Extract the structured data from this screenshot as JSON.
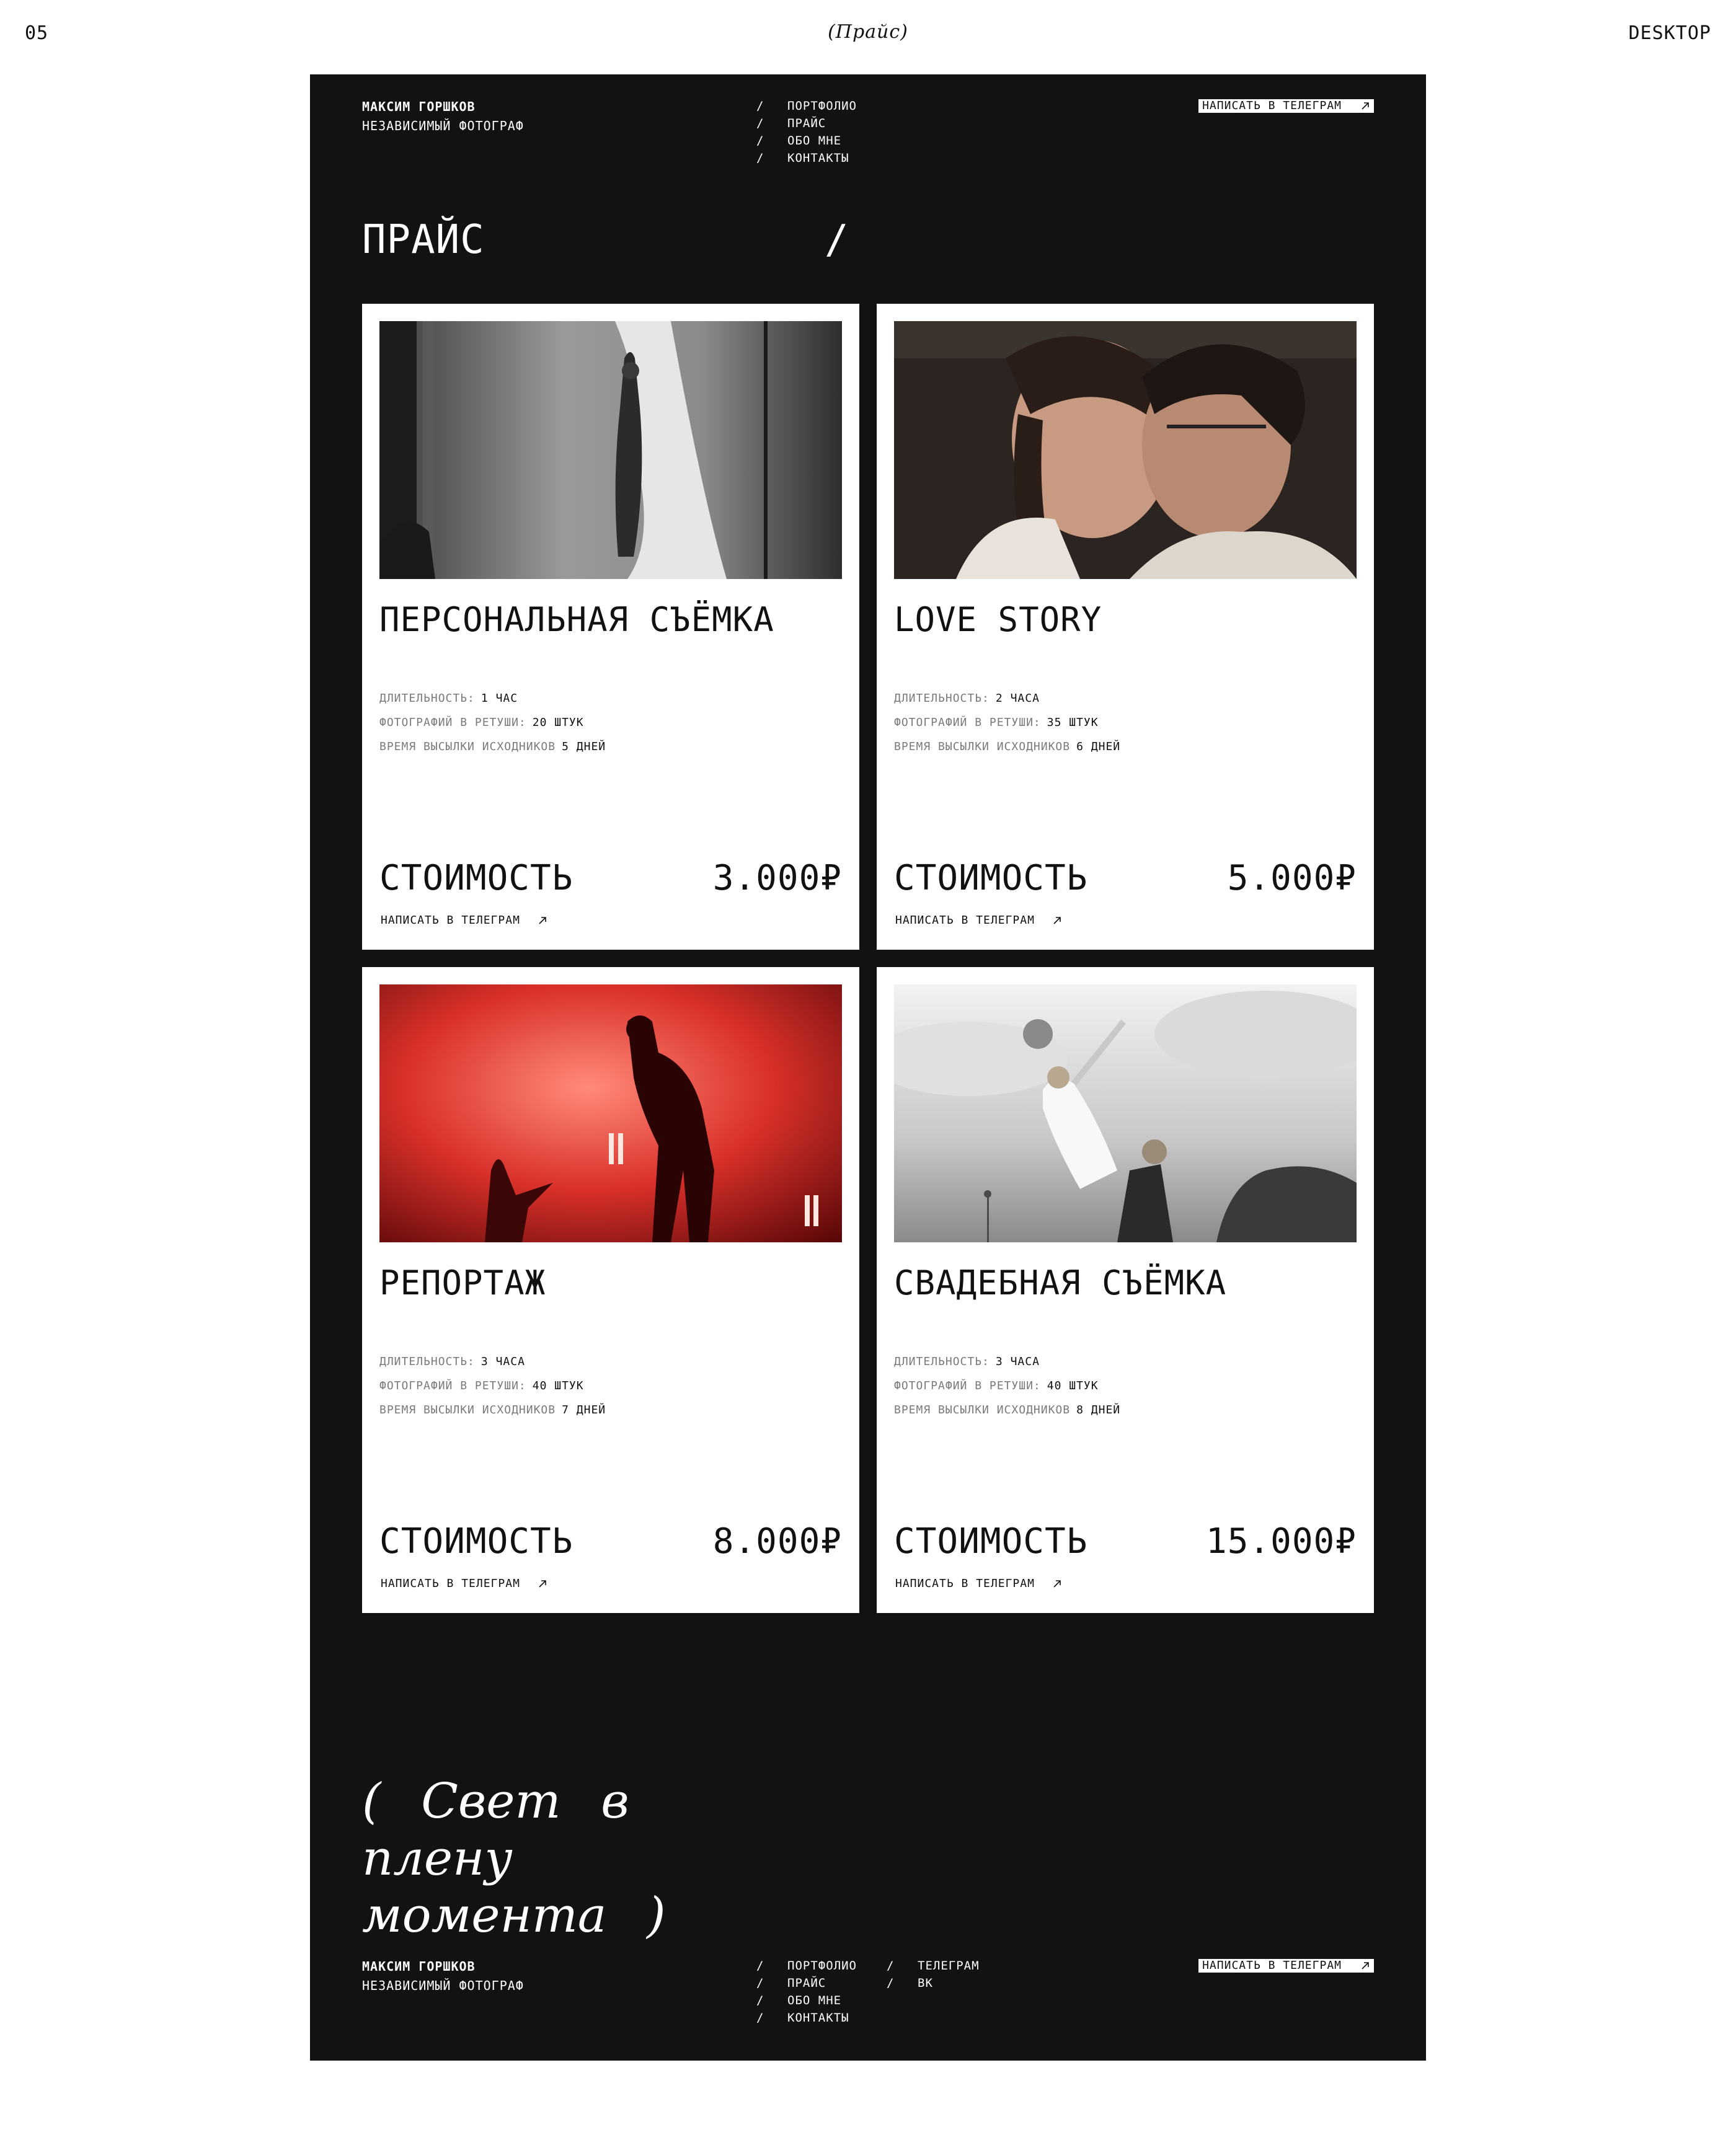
{
  "labels": {
    "number": "05",
    "page": "(Прайс)",
    "device": "DESKTOP"
  },
  "header": {
    "name": "МАКСИМ ГОРШКОВ",
    "role": "НЕЗАВИСИМЫЙ ФОТОГРАФ",
    "nav": [
      {
        "slash": "/",
        "label": "ПОРТФОЛИО"
      },
      {
        "slash": "/",
        "label": "ПРАЙС"
      },
      {
        "slash": "/",
        "label": "ОБО МНЕ"
      },
      {
        "slash": "/",
        "label": "КОНТАКТЫ"
      }
    ],
    "cta": "НАПИСАТЬ В ТЕЛЕГРАМ"
  },
  "page": {
    "title": "ПРАЙС",
    "title_slash": "/"
  },
  "cards": [
    {
      "title": "ПЕРСОНАЛЬНАЯ СЪЁМКА",
      "specs": [
        {
          "key": "ДЛИТЕЛЬНОСТЬ:",
          "value": "1 ЧАС"
        },
        {
          "key": "ФОТОГРАФИЙ В РЕТУШИ:",
          "value": "20 ШТУК"
        },
        {
          "key": "ВРЕМЯ ВЫСЫЛКИ ИСХОДНИКОВ",
          "value": "5 ДНЕЙ"
        }
      ],
      "cost_label": "СТОИМОСТЬ",
      "price": "3.000₽",
      "cta": "НАПИСАТЬ В ТЕЛЕГРАМ"
    },
    {
      "title": "LOVE STORY",
      "specs": [
        {
          "key": "ДЛИТЕЛЬНОСТЬ:",
          "value": "2 ЧАСА"
        },
        {
          "key": "ФОТОГРАФИЙ В РЕТУШИ:",
          "value": "35 ШТУК"
        },
        {
          "key": "ВРЕМЯ ВЫСЫЛКИ ИСХОДНИКОВ",
          "value": "6 ДНЕЙ"
        }
      ],
      "cost_label": "СТОИМОСТЬ",
      "price": "5.000₽",
      "cta": "НАПИСАТЬ В ТЕЛЕГРАМ"
    },
    {
      "title": "РЕПОРТАЖ",
      "specs": [
        {
          "key": "ДЛИТЕЛЬНОСТЬ:",
          "value": "3 ЧАСА"
        },
        {
          "key": "ФОТОГРАФИЙ В РЕТУШИ:",
          "value": "40 ШТУК"
        },
        {
          "key": "ВРЕМЯ ВЫСЫЛКИ ИСХОДНИКОВ",
          "value": "7 ДНЕЙ"
        }
      ],
      "cost_label": "СТОИМОСТЬ",
      "price": "8.000₽",
      "cta": "НАПИСАТЬ В ТЕЛЕГРАМ"
    },
    {
      "title": "СВАДЕБНАЯ СЪЁМКА",
      "specs": [
        {
          "key": "ДЛИТЕЛЬНОСТЬ:",
          "value": "3 ЧАСА"
        },
        {
          "key": "ФОТОГРАФИЙ В РЕТУШИ:",
          "value": "40 ШТУК"
        },
        {
          "key": "ВРЕМЯ ВЫСЫЛКИ ИСХОДНИКОВ",
          "value": "8 ДНЕЙ"
        }
      ],
      "cost_label": "СТОИМОСТЬ",
      "price": "15.000₽",
      "cta": "НАПИСАТЬ В ТЕЛЕГРАМ"
    }
  ],
  "slogan": "( Свет в плену момента )",
  "footer": {
    "name": "МАКСИМ ГОРШКОВ",
    "role": "НЕЗАВИСИМЫЙ ФОТОГРАФ",
    "nav": [
      {
        "slash": "/",
        "label": "ПОРТФОЛИО"
      },
      {
        "slash": "/",
        "label": "ПРАЙС"
      },
      {
        "slash": "/",
        "label": "ОБО МНЕ"
      },
      {
        "slash": "/",
        "label": "КОНТАКТЫ"
      }
    ],
    "social": [
      {
        "slash": "/",
        "label": "ТЕЛЕГРАМ"
      },
      {
        "slash": "/",
        "label": "ВК"
      }
    ],
    "cta": "НАПИСАТЬ В ТЕЛЕГРАМ"
  },
  "colors": {
    "page_bg": "#ffffff",
    "frame_bg": "#121212",
    "card_bg": "#ffffff",
    "muted": "#7a7a7a"
  }
}
